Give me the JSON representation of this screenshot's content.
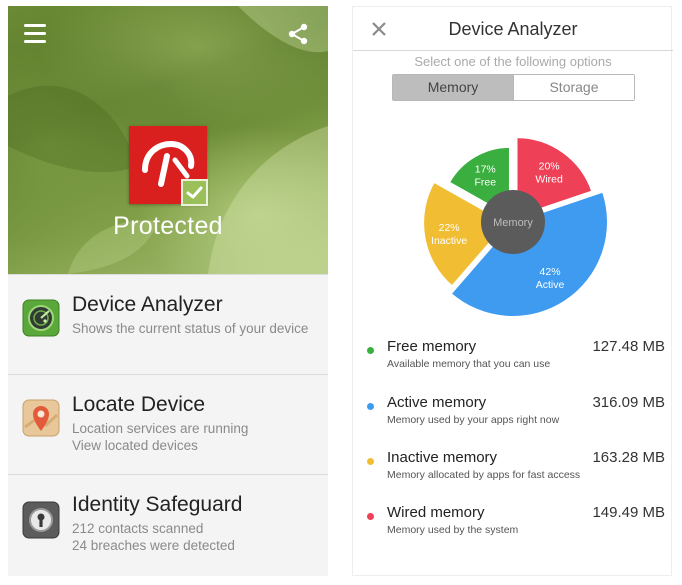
{
  "home": {
    "status": "Protected",
    "features": [
      {
        "title": "Device Analyzer",
        "lines": [
          "Shows the current status of your device"
        ]
      },
      {
        "title": "Locate Device",
        "lines": [
          "Location services are running",
          "View located devices"
        ]
      },
      {
        "title": "Identity Safeguard",
        "lines": [
          "212 contacts scanned",
          "24 breaches were detected"
        ]
      }
    ]
  },
  "analyzer": {
    "title": "Device Analyzer",
    "prompt": "Select one of the following options",
    "tabs": [
      {
        "label": "Memory",
        "selected": true
      },
      {
        "label": "Storage",
        "selected": false
      }
    ],
    "center_label": "Memory",
    "legend": [
      {
        "name": "Free memory",
        "desc": "Available memory that you can use",
        "value": "127.48 MB",
        "color": "#3aae3f"
      },
      {
        "name": "Active memory",
        "desc": "Memory used by your apps right now",
        "value": "316.09 MB",
        "color": "#3f9bf0"
      },
      {
        "name": "Inactive memory",
        "desc": "Memory allocated by apps for fast access",
        "value": "163.28 MB",
        "color": "#f0bd33"
      },
      {
        "name": "Wired memory",
        "desc": "Memory used by the system",
        "value": "149.49 MB",
        "color": "#ee4056"
      }
    ]
  },
  "chart_data": {
    "type": "pie",
    "title": "",
    "center_label": "Memory",
    "slices": [
      {
        "label": "Wired",
        "value": 20,
        "display": "20%",
        "color": "#ee4056"
      },
      {
        "label": "Active",
        "value": 42,
        "display": "42%",
        "color": "#3f9bf0"
      },
      {
        "label": "Inactive",
        "value": 22,
        "display": "22%",
        "color": "#f0bd33"
      },
      {
        "label": "Free",
        "value": 17,
        "display": "17%",
        "color": "#3aae3f"
      }
    ]
  },
  "colors": {
    "brand_red": "#d9201f",
    "check_green": "#9bc05a",
    "center_dark": "#5b5b5b"
  },
  "icons": [
    "menu-icon",
    "share-icon",
    "umbrella-logo-icon",
    "checkmark-icon",
    "radar-icon",
    "location-pin-icon",
    "keyhole-lock-icon",
    "close-icon"
  ]
}
